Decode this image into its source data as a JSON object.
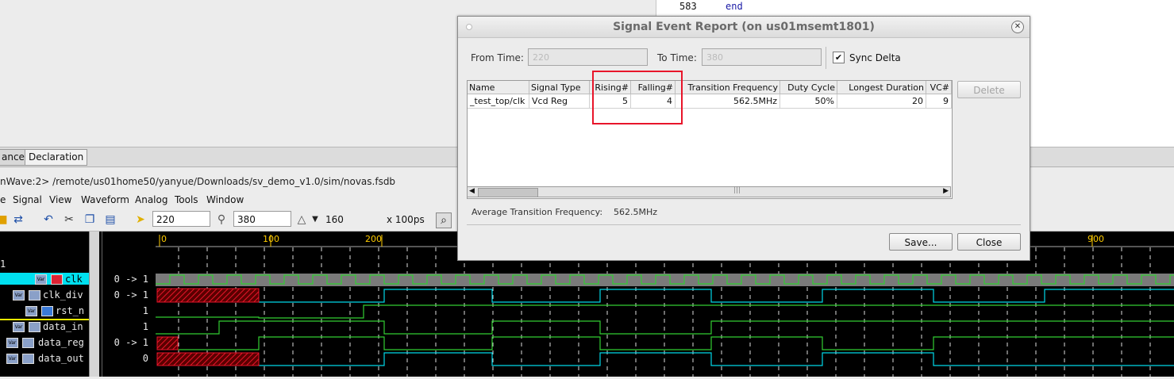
{
  "editor": {
    "line_number": "583",
    "line_code": "end"
  },
  "tabs": {
    "instance": "ance",
    "declaration": "Declaration"
  },
  "path_bar": "nWave:2> /remote/us01home50/yanyue/Downloads/sv_demo_v1.0/sim/novas.fsdb",
  "menu": [
    "e",
    "Signal",
    "View",
    "Waveform",
    "Analog",
    "Tools",
    "Window"
  ],
  "toolbar": {
    "cursor_time": "220",
    "marker_time": "380",
    "delta": "160",
    "units": "x 100ps"
  },
  "ruler": [
    "0",
    "100",
    "200",
    "900"
  ],
  "signal_pane": {
    "group_index": "1"
  },
  "signals": [
    {
      "name": "clk",
      "value": "0 -> 1"
    },
    {
      "name": "clk_div",
      "value": "0 -> 1"
    },
    {
      "name": "rst_n",
      "value": "1"
    },
    {
      "name": "data_in",
      "value": "1"
    },
    {
      "name": "data_reg",
      "value": "0 -> 1"
    },
    {
      "name": "data_out",
      "value": "0"
    }
  ],
  "dialog": {
    "title": "Signal Event Report (on us01msemt1801)",
    "from_label": "From Time:",
    "from_value": "220",
    "to_label": "To Time:",
    "to_value": "380",
    "sync_label": "Sync Delta",
    "sync_checked": true,
    "columns": [
      "Name",
      "Signal Type",
      "Rising#",
      "Falling#",
      "Transition Frequency",
      "Duty Cycle",
      "Longest Duration",
      "VC#"
    ],
    "rows": [
      [
        "_test_top/clk",
        "Vcd Reg",
        "5",
        "4",
        "562.5MHz",
        "50%",
        "20",
        "9"
      ]
    ],
    "avg_label": "Average Transition Frequency:",
    "avg_value": "562.5MHz",
    "delete_label": "Delete",
    "save_label": "Save...",
    "close_label": "Close"
  },
  "colors": {
    "highlight": "#e8152a",
    "wave_green": "#32cd32",
    "wave_cyan": "#00d8e8",
    "selection": "#00e0f0"
  }
}
